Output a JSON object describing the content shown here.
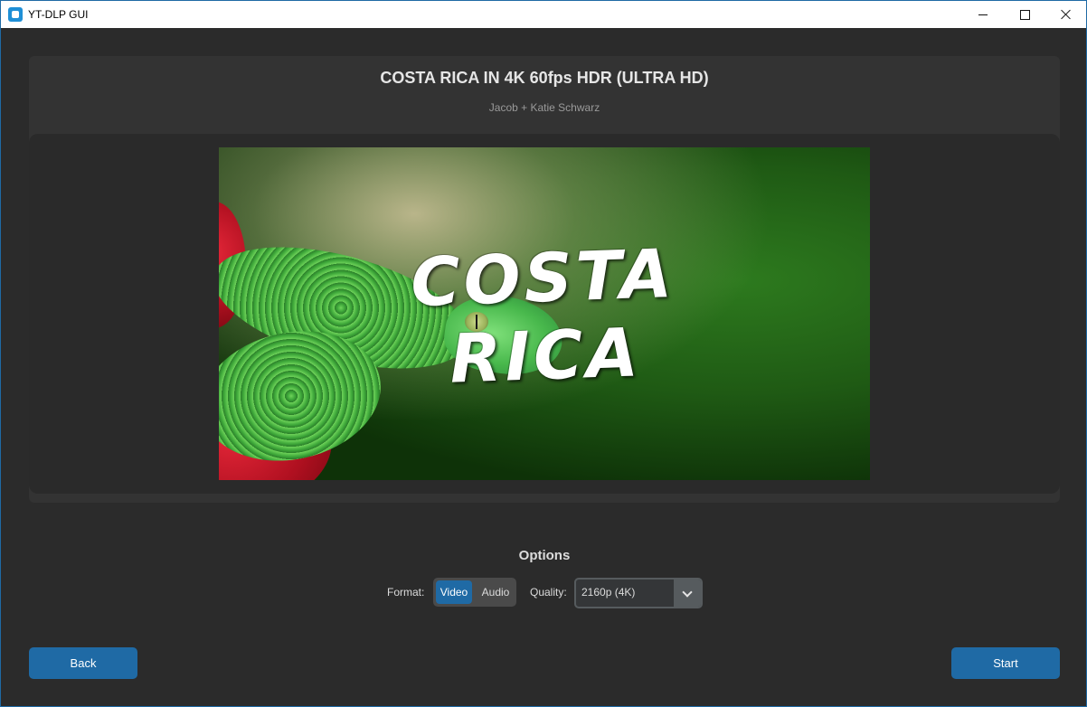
{
  "window": {
    "title": "YT-DLP GUI",
    "accent_color": "#1f6aa5"
  },
  "video": {
    "title": "COSTA RICA IN 4K 60fps HDR (ULTRA HD)",
    "author": "Jacob + Katie Schwarz",
    "thumbnail_text": "COSTA RICA",
    "thumbnail_subject": "green pit viper snake on red flower"
  },
  "options": {
    "heading": "Options",
    "format_label": "Format:",
    "format_options": [
      "Video",
      "Audio"
    ],
    "format_selected": "Video",
    "quality_label": "Quality:",
    "quality_selected": "2160p (4K)"
  },
  "buttons": {
    "back": "Back",
    "start": "Start"
  },
  "icons": {
    "app": "app-icon",
    "minimize": "minimize-icon",
    "maximize": "maximize-icon",
    "close": "close-icon",
    "dropdown": "chevron-down-icon"
  }
}
